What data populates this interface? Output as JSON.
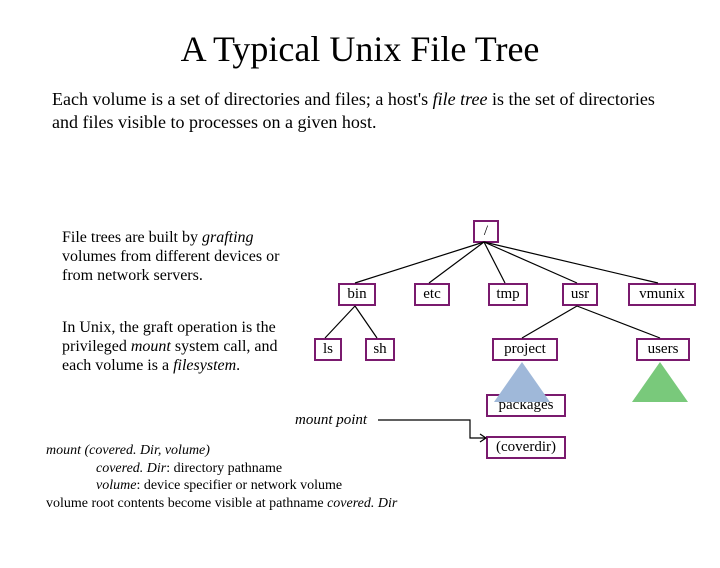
{
  "title": "A Typical Unix File Tree",
  "intro_part1": "Each volume is a set of directories and files; a host's ",
  "intro_italic1": "file tree",
  "intro_part2": " is the set of directories and files visible to processes on a given host.",
  "para1_a": "File trees are built by ",
  "para1_italic": "grafting",
  "para1_b": " volumes from different devices or from network servers.",
  "para2_a": "In Unix, the graft operation is the privileged ",
  "para2_italic1": "mount",
  "para2_b": " system call, and each volume is a ",
  "para2_italic2": "filesystem",
  "para2_c": ".",
  "nodes": {
    "root": "/",
    "bin": "bin",
    "etc": "etc",
    "tmp": "tmp",
    "usr": "usr",
    "vmunix": "vmunix",
    "ls": "ls",
    "sh": "sh",
    "project": "project",
    "users": "users",
    "packages": "packages",
    "coverdir": "(coverdir)"
  },
  "mountpoint_label": "mount point",
  "syntax": {
    "l1a": "mount (covered. Dir, volume)",
    "l2a": "covered. Dir",
    "l2b": ": directory pathname",
    "l3a": "volume",
    "l3b": ": device specifier or network volume",
    "l4a": "volume root contents become visible at pathname ",
    "l4b": "covered. Dir"
  }
}
